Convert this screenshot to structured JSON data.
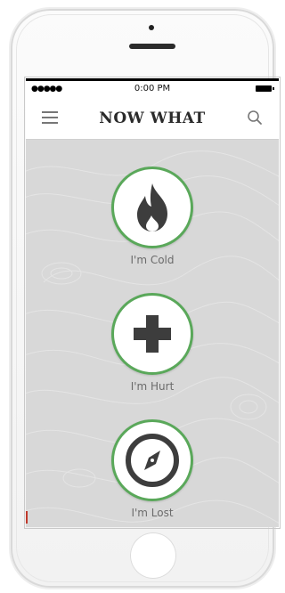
{
  "status_bar": {
    "signal": "●●●●●",
    "time": "0:00 PM"
  },
  "header": {
    "title": "NOW WHAT",
    "menu_icon": "hamburger-menu-icon",
    "search_icon": "search-icon"
  },
  "options": [
    {
      "label": "I'm Cold",
      "icon": "flame-icon"
    },
    {
      "label": "I'm Hurt",
      "icon": "medical-cross-icon"
    },
    {
      "label": "I'm Lost",
      "icon": "compass-icon"
    }
  ],
  "colors": {
    "accent_ring": "#5aa85a",
    "icon_dark": "#3d3d3d",
    "background": "#d8d8d8"
  }
}
